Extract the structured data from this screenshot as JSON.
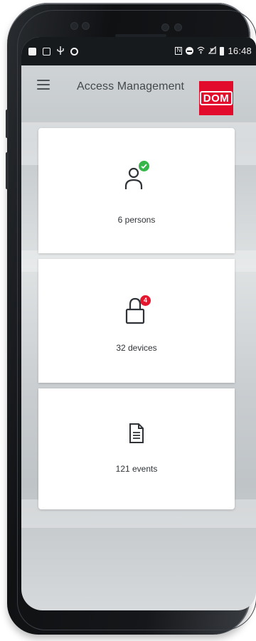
{
  "status_bar": {
    "time": "16:48",
    "left_icons": [
      "image-icon",
      "app-icon",
      "usb-icon",
      "circle-icon"
    ],
    "right_icons": [
      "nfc-icon",
      "dnd-icon",
      "wifi-icon",
      "signal-icon",
      "battery-icon"
    ]
  },
  "app_bar": {
    "title": "Access Management",
    "logo_text": "DOM"
  },
  "cards": [
    {
      "label": "6 persons",
      "icon": "person-icon",
      "badge_icon": "check-icon",
      "badge_color": "#35b54a"
    },
    {
      "label": "32 devices",
      "icon": "lock-icon",
      "badge": "4",
      "badge_color": "#e4172e"
    },
    {
      "label": "121 events",
      "icon": "document-icon"
    }
  ],
  "colors": {
    "brand": "#e30b2c",
    "statusbar": "#171a1d",
    "text": "#44494d"
  }
}
